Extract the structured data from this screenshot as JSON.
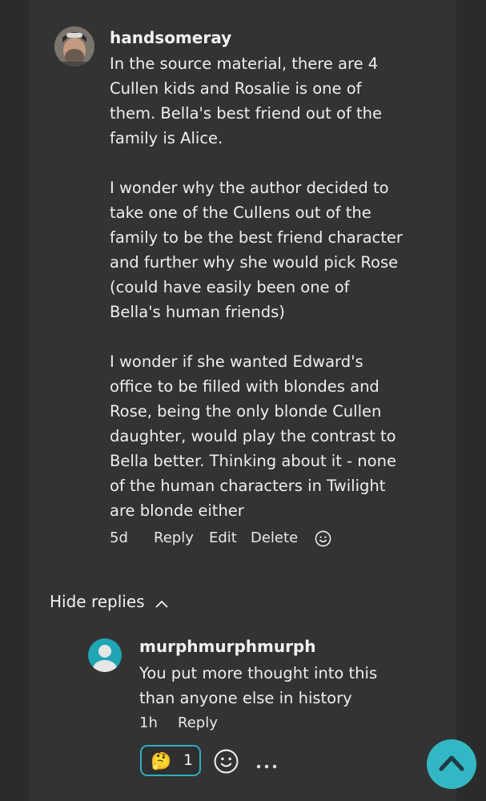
{
  "comment": {
    "username": "handsomeray",
    "text": "In the source material, there are 4\nCullen kids and Rosalie is one of\nthem. Bella's best friend out of the\nfamily is Alice.\n\nI wonder why the author decided to\ntake one of the Cullens out of the\nfamily to be the best friend character\nand further why she would pick Rose\n(could have easily been one of\nBella's human friends)\n\nI wonder if she wanted Edward's\noffice to be filled with blondes and\nRose, being the only blonde Cullen\ndaughter, would play the contrast to\nBella better. Thinking about it - none\nof the human characters in Twilight\nare blonde either",
    "time": "5d",
    "reply_label": "Reply",
    "edit_label": "Edit",
    "delete_label": "Delete",
    "react_icon": "smiley-icon"
  },
  "hide_replies_label": "Hide replies",
  "reply": {
    "username": "murphmurphmurph",
    "text": "You put more thought into this\nthan anyone else in history",
    "time": "1h",
    "reply_label": "Reply",
    "reaction": {
      "emoji": "🤔",
      "count": "1"
    },
    "react_icon": "smiley-icon",
    "more_icon": "more-dots-icon"
  },
  "scroll_top_icon": "chevron-up-icon",
  "colors": {
    "accent": "#34b7c4",
    "background": "#333333"
  }
}
